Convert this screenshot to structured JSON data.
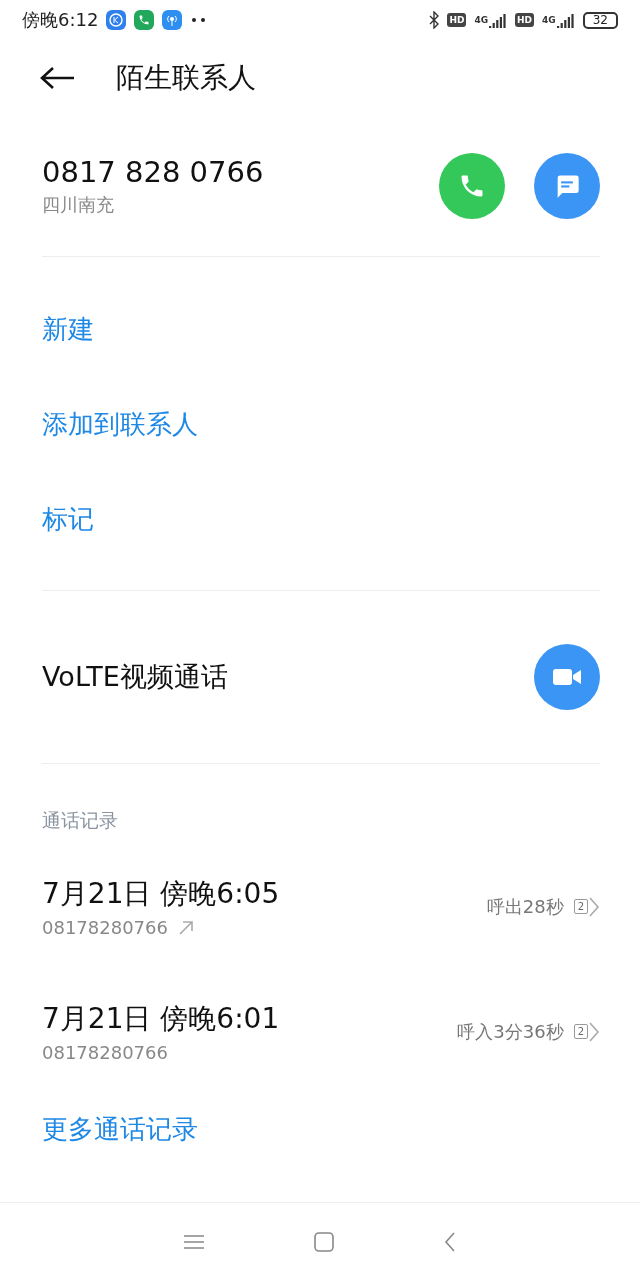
{
  "status_bar": {
    "time": "傍晚6:12",
    "hd_1": "HD",
    "network_1": "4G",
    "hd_2": "HD",
    "network_2": "4G",
    "battery": "32"
  },
  "header": {
    "title": "陌生联系人"
  },
  "contact": {
    "number": "0817 828 0766",
    "location": "四川南充"
  },
  "actions": [
    {
      "label": "新建"
    },
    {
      "label": "添加到联系人"
    },
    {
      "label": "标记"
    }
  ],
  "video_call": {
    "label": "VoLTE视频通话"
  },
  "call_log": {
    "title": "通话记录",
    "entries": [
      {
        "time": "7月21日 傍晚6:05",
        "number": "08178280766",
        "kind": "outgoing",
        "summary": "呼出28秒",
        "sim": "2"
      },
      {
        "time": "7月21日 傍晚6:01",
        "number": "08178280766",
        "kind": "incoming",
        "summary": "呼入3分36秒",
        "sim": "2"
      }
    ],
    "more": "更多通话记录"
  }
}
